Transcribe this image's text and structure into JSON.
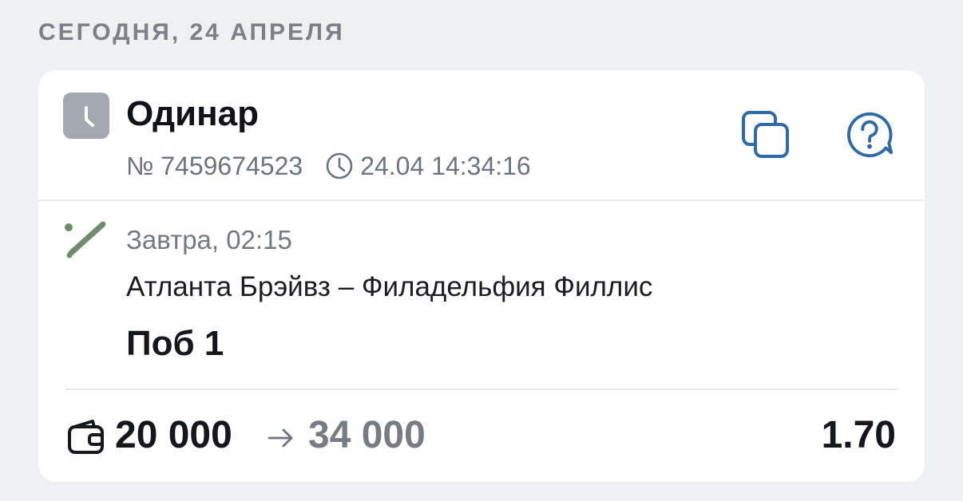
{
  "date_header": "СЕГОДНЯ, 24 АПРЕЛЯ",
  "bet": {
    "type": "Одинар",
    "number": "№ 7459674523",
    "placed_at": "24.04 14:34:16",
    "status_icon": "clock-icon",
    "actions": {
      "copy_icon": "copy-icon",
      "help_icon": "help-chat-icon"
    },
    "event": {
      "sport_icon": "baseball-bat-icon",
      "time": "Завтра, 02:15",
      "name": "Атланта Брэйвз – Филадельфия Филлис",
      "outcome": "Поб 1"
    },
    "footer": {
      "wallet_icon": "wallet-icon",
      "stake": "20 000",
      "arrow_icon": "arrow-right-icon",
      "payout": "34 000",
      "odds": "1.70"
    }
  },
  "colors": {
    "page_bg": "#eff0f2",
    "card_bg": "#ffffff",
    "accent_blue": "#2f6aa6",
    "sport_green": "#6f8c6f",
    "muted_text": "#747880",
    "badge_gray": "#a4a8b0"
  }
}
